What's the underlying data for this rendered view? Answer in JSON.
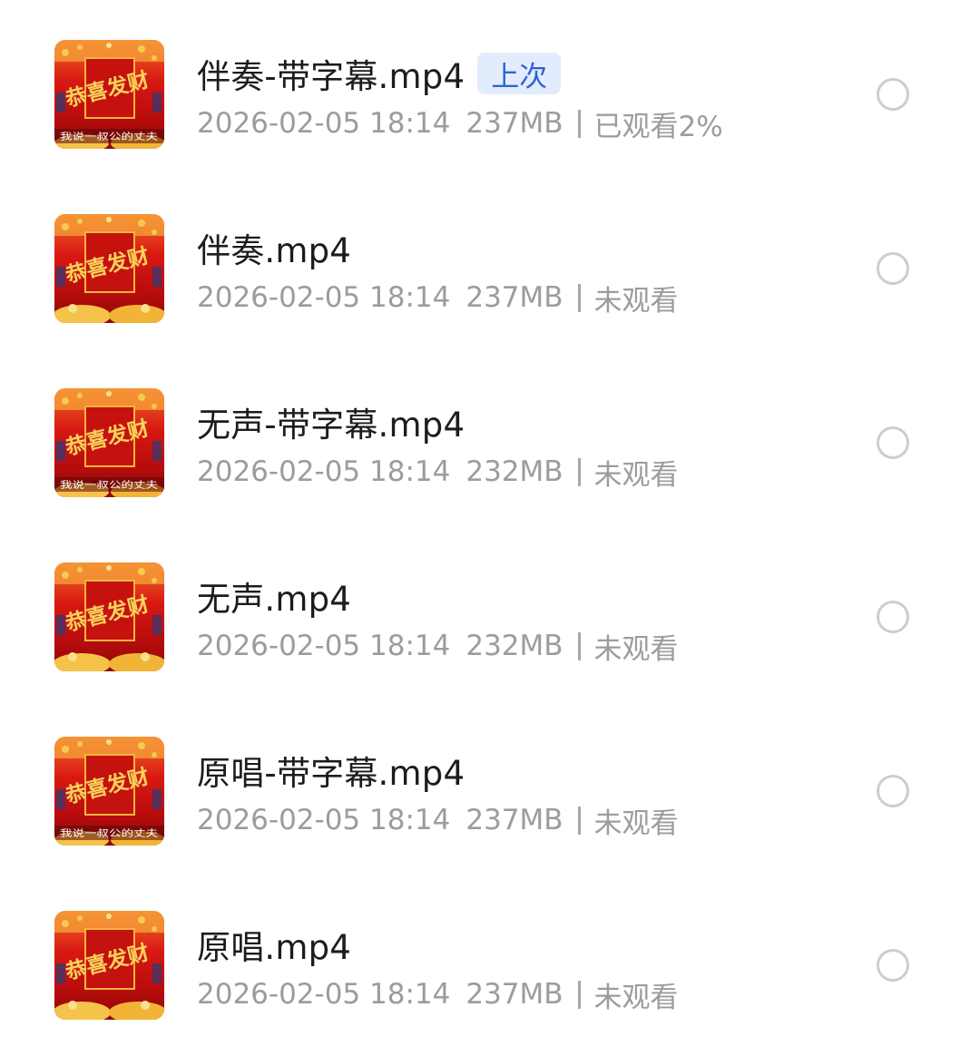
{
  "files": [
    {
      "name": "伴奏-带字幕.mp4",
      "badge": "上次",
      "date": "2026-02-05 18:14",
      "size": "237MB",
      "status": "已观看2%",
      "thumbnail": {
        "calligraphy": "恭喜发财",
        "caption": "我说一叔公的丈夫"
      }
    },
    {
      "name": "伴奏.mp4",
      "date": "2026-02-05 18:14",
      "size": "237MB",
      "status": "未观看",
      "thumbnail": {
        "calligraphy": "恭喜发财"
      }
    },
    {
      "name": "无声-带字幕.mp4",
      "date": "2026-02-05 18:14",
      "size": "232MB",
      "status": "未观看",
      "thumbnail": {
        "calligraphy": "恭喜发财",
        "caption": "我说一叔公的丈夫"
      }
    },
    {
      "name": "无声.mp4",
      "date": "2026-02-05 18:14",
      "size": "232MB",
      "status": "未观看",
      "thumbnail": {
        "calligraphy": "恭喜发财"
      }
    },
    {
      "name": "原唱-带字幕.mp4",
      "date": "2026-02-05 18:14",
      "size": "237MB",
      "status": "未观看",
      "thumbnail": {
        "calligraphy": "恭喜发财",
        "caption": "我说一叔公的丈夫"
      }
    },
    {
      "name": "原唱.mp4",
      "date": "2026-02-05 18:14",
      "size": "237MB",
      "status": "未观看",
      "thumbnail": {
        "calligraphy": "恭喜发财"
      }
    }
  ],
  "colors": {
    "name_text": "#1c1c1c",
    "meta_text": "#9c9c9c",
    "badge_background": "#e3ecfc",
    "badge_text": "#2f63d6",
    "radio_border": "#cdcdcd",
    "thumbnail_red": "#d81812",
    "thumbnail_gold": "#f5c24a"
  },
  "icons": {
    "thumbnail": "video-thumbnail",
    "select": "radio-circle-icon"
  }
}
